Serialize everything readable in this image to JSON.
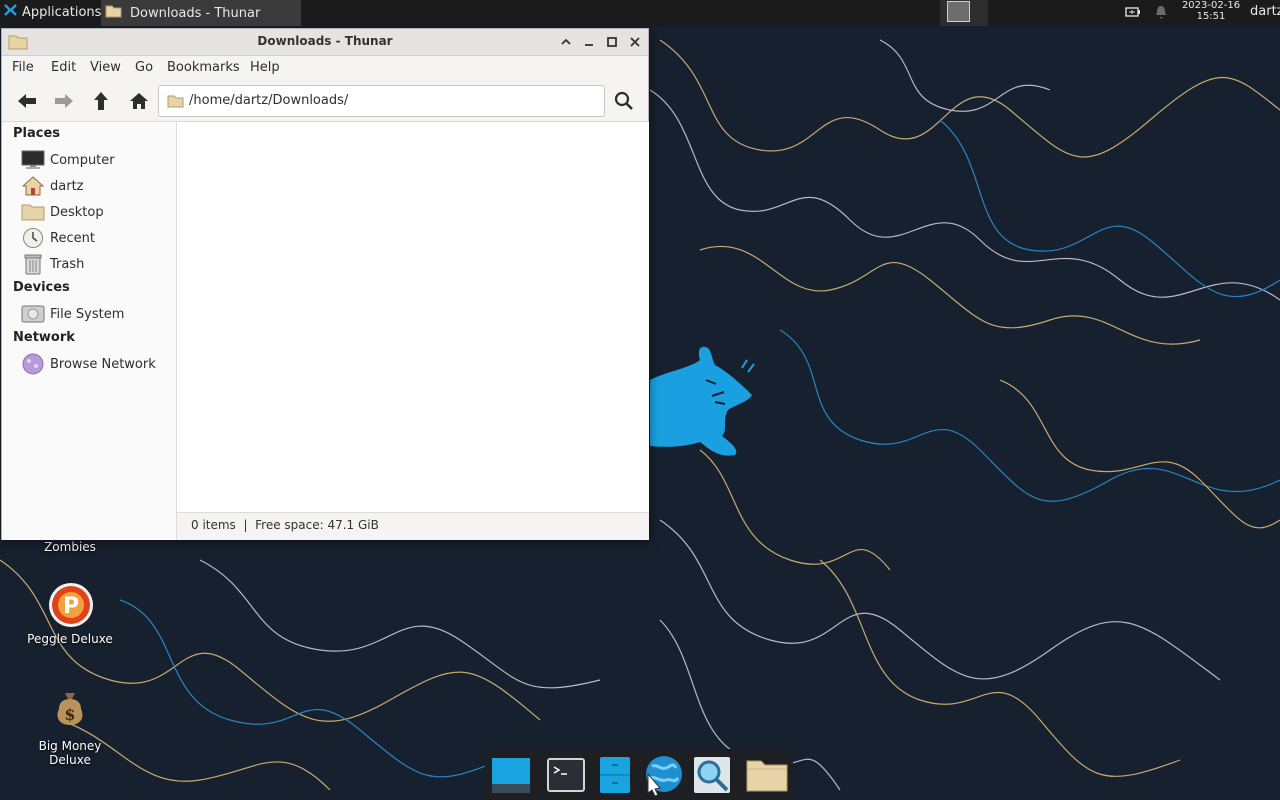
{
  "top_panel": {
    "applications_label": "Applications",
    "task_title": "Downloads - Thunar",
    "date": "2023-02-16",
    "time": "15:51",
    "user": "dartz"
  },
  "window": {
    "title": "Downloads - Thunar",
    "menu": [
      "File",
      "Edit",
      "View",
      "Go",
      "Bookmarks",
      "Help"
    ],
    "location": "/home/dartz/Downloads/",
    "sidebar": {
      "places_title": "Places",
      "places": [
        "Computer",
        "dartz",
        "Desktop",
        "Recent",
        "Trash"
      ],
      "devices_title": "Devices",
      "devices": [
        "File System"
      ],
      "network_title": "Network",
      "network": [
        "Browse Network"
      ]
    },
    "status": "0 items  |  Free space: 47.1 GiB"
  },
  "desktop_icons": {
    "zombies": "Zombies",
    "peggle": "Peggle Deluxe",
    "bigmoney_line1": "Big Money",
    "bigmoney_line2": "Deluxe"
  },
  "dock": [
    "show-desktop",
    "terminal",
    "file-manager",
    "web-browser",
    "app-finder",
    "home-folder"
  ],
  "colors": {
    "wallpaper_bg": "#17202e",
    "mouse_blue": "#1aa0e0",
    "panel": "#1b1b1b"
  }
}
